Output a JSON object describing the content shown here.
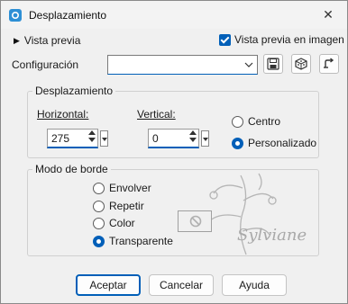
{
  "window": {
    "title": "Desplazamiento",
    "close_glyph": "✕"
  },
  "preview": {
    "toggle_label": "Vista previa",
    "image_preview_label": "Vista previa en imagen",
    "image_preview_checked": true
  },
  "config": {
    "label": "Configuración",
    "value": ""
  },
  "displacement": {
    "group_title": "Desplazamiento",
    "horizontal_label": "Horizontal:",
    "horizontal_value": "275",
    "vertical_label": "Vertical:",
    "vertical_value": "0",
    "center_label": "Centro",
    "custom_label": "Personalizado",
    "selected": "custom"
  },
  "border_mode": {
    "group_title": "Modo de borde",
    "options": [
      {
        "label": "Envolver",
        "selected": false
      },
      {
        "label": "Repetir",
        "selected": false
      },
      {
        "label": "Color",
        "selected": false
      },
      {
        "label": "Transparente",
        "selected": true
      }
    ]
  },
  "watermark_text": "Sylviane",
  "buttons": {
    "ok": "Aceptar",
    "cancel": "Cancelar",
    "help": "Ayuda"
  },
  "colors": {
    "accent": "#005fb8",
    "background": "#f0f0f0"
  }
}
